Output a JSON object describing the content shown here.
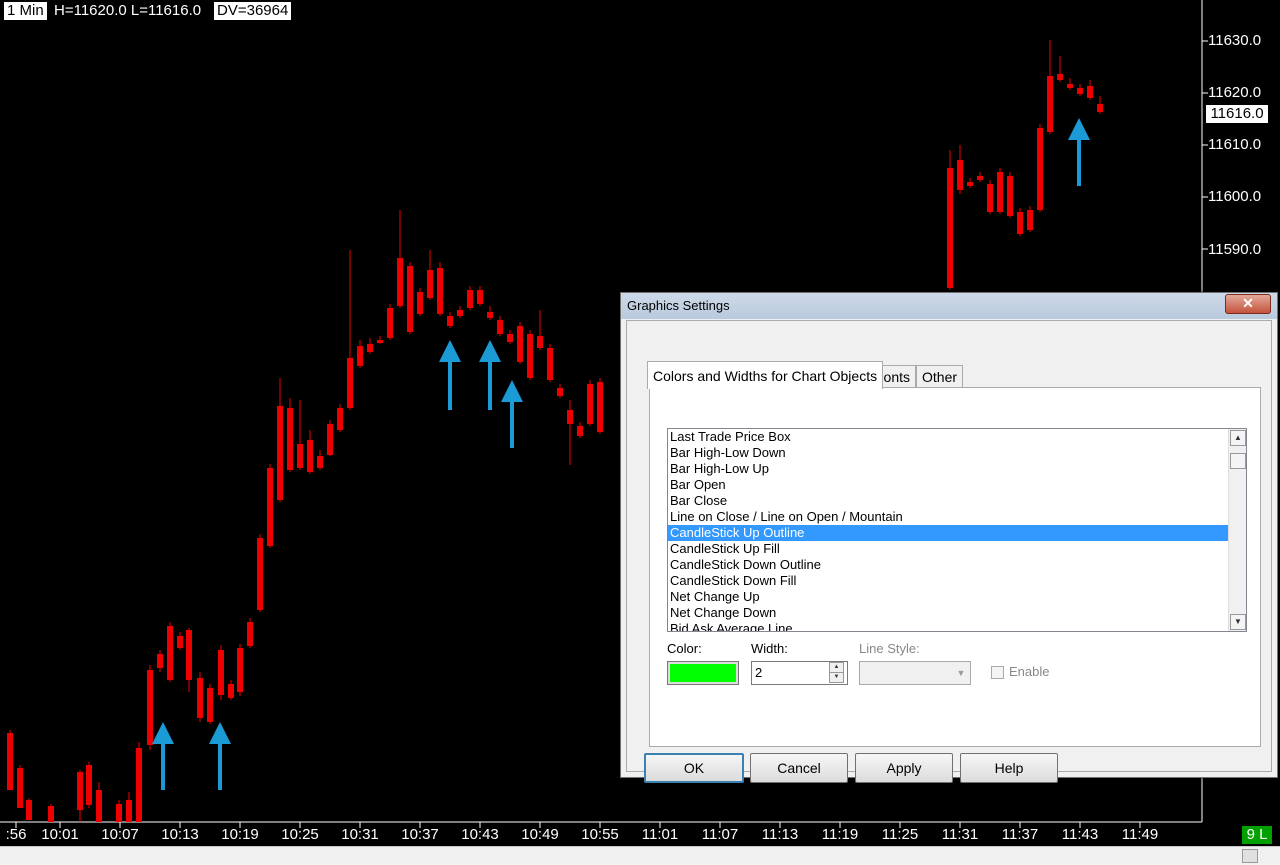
{
  "chart": {
    "interval": "1 Min",
    "high": "H=11620.0",
    "low": "L=11616.0",
    "dv": "DV=36964",
    "price_labels": [
      "11630.0",
      "11620.0",
      "11610.0",
      "11600.0",
      "11590.0"
    ],
    "last_price": "11616.0",
    "time_labels": [
      ":56",
      "10:01",
      "10:07",
      "10:13",
      "10:19",
      "10:25",
      "10:31",
      "10:37",
      "10:43",
      "10:49",
      "10:55",
      "11:01",
      "11:07",
      "11:13",
      "11:19",
      "11:25",
      "11:31",
      "11:37",
      "11:43",
      "11:49"
    ],
    "status": "9 L",
    "colors": {
      "up": "#00ee00",
      "down": "#ee0000",
      "arrow": "#1b9ad6",
      "background": "#000000"
    }
  },
  "dialog": {
    "title": "Graphics Settings",
    "close_label": "✕",
    "tabs": [
      {
        "label": "Colors and Widths for Chart Objects",
        "active": true
      },
      {
        "label": "Fonts",
        "active": false
      },
      {
        "label": "Other",
        "active": false
      }
    ],
    "list_items": [
      "Last Trade Price Box",
      "Bar High-Low Down",
      "Bar High-Low Up",
      "Bar Open",
      "Bar Close",
      "Line on Close / Line on Open / Mountain",
      "CandleStick Up Outline",
      "CandleStick Up Fill",
      "CandleStick Down Outline",
      "CandleStick Down Fill",
      "Net Change Up",
      "Net Change Down",
      "Bid Ask Average Line"
    ],
    "selected_item": "CandleStick Up Outline",
    "color_label": "Color:",
    "color_value": "#00ff00",
    "width_label": "Width:",
    "width_value": "2",
    "line_style_label": "Line Style:",
    "line_style_value": "",
    "enable_label": "Enable",
    "buttons": {
      "ok": "OK",
      "cancel": "Cancel",
      "apply": "Apply",
      "help": "Help"
    }
  }
}
